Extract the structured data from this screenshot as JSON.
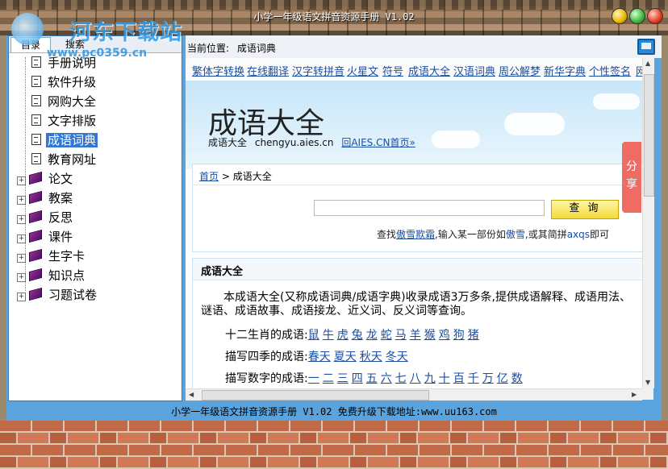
{
  "window": {
    "title": "小学一年级语文拼音资源手册 V1.02"
  },
  "watermark": {
    "text": "河东下载站",
    "url": "www.pc0359.cn"
  },
  "tabs": {
    "directory": "目录",
    "search": "搜索"
  },
  "tree": {
    "items": [
      {
        "label": "手册说明",
        "kind": "doc"
      },
      {
        "label": "软件升级",
        "kind": "doc"
      },
      {
        "label": "网购大全",
        "kind": "doc"
      },
      {
        "label": "文字排版",
        "kind": "doc"
      },
      {
        "label": "成语词典",
        "kind": "doc-open",
        "selected": true
      },
      {
        "label": "教育网址",
        "kind": "doc"
      },
      {
        "label": "论文",
        "kind": "book"
      },
      {
        "label": "教案",
        "kind": "book"
      },
      {
        "label": "反思",
        "kind": "book"
      },
      {
        "label": "课件",
        "kind": "book"
      },
      {
        "label": "生字卡",
        "kind": "book"
      },
      {
        "label": "知识点",
        "kind": "book"
      },
      {
        "label": "习题试卷",
        "kind": "book"
      }
    ]
  },
  "location": {
    "label": "当前位置:",
    "value": "成语词典"
  },
  "nav_links": [
    "繁体字转换",
    "在线翻译",
    "汉字转拼音",
    "火星文",
    "符号",
    "成语大全",
    "汉语词典",
    "周公解梦",
    "新华字典",
    "个性签名",
    "网"
  ],
  "site": {
    "title": "成语大全",
    "sub_label": "成语大全",
    "sub_url": "chengyu.aies.cn",
    "home_link": "回AIES.CN首页»"
  },
  "breadcrumb": {
    "home": "首页",
    "sep": " > ",
    "current": "成语大全"
  },
  "search": {
    "button": "查 询",
    "placeholder": "",
    "hint_prefix": "查找",
    "hint_example1": "傲雪欺霜",
    "hint_mid": ",输入某一部份如",
    "hint_example2": "傲雪",
    "hint_mid2": ",或其简拼",
    "hint_example3": "axqs",
    "hint_suffix": "即可"
  },
  "section": {
    "title": "成语大全",
    "intro": "本成语大全(又称成语词典/成语字典)收录成语3万多条,提供成语解释、成语用法、谜语、成语故事、成语接龙、近义词、反义词等查询。",
    "rows": [
      {
        "label": "十二生肖的成语:",
        "items": [
          "鼠",
          "牛",
          "虎",
          "兔",
          "龙",
          "蛇",
          "马",
          "羊",
          "猴",
          "鸡",
          "狗",
          "猪"
        ]
      },
      {
        "label": "描写四季的成语:",
        "items": [
          "春天",
          "夏天",
          "秋天",
          "冬天"
        ]
      },
      {
        "label": "描写数字的成语:",
        "items": [
          "一",
          "二",
          "三",
          "四",
          "五",
          "六",
          "七",
          "八",
          "九",
          "十",
          "百",
          "千",
          "万",
          "亿",
          "数"
        ]
      }
    ]
  },
  "share": {
    "label": "分享"
  },
  "status": {
    "text": "小学一年级语文拼音资源手册 V1.02  免费升级下载地址:www.uu163.com"
  },
  "colors": {
    "frame_blue": "#5aa3dd",
    "link_blue": "#1a4ea3",
    "selection": "#3277d2",
    "share_red": "#ef6c64",
    "search_button": "#f3d93a"
  }
}
